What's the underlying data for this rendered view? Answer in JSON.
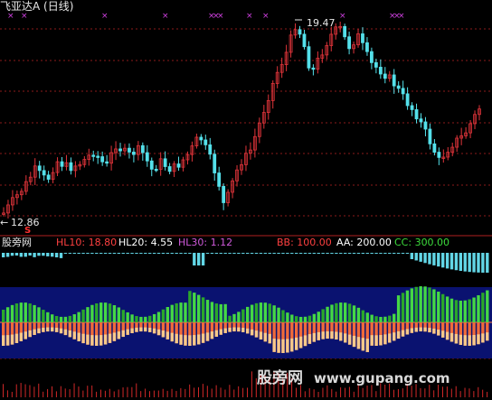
{
  "title": "飞亚达A (日线)",
  "price_high_label": "19.47",
  "price_low_label": "12.86",
  "low_arrow": "←",
  "signal_s": "S",
  "indicator": {
    "name": "股旁网",
    "hl10": "HL10: 18.80",
    "hl20": "HL20: 4.55",
    "hl30": "HL30: 1.12",
    "bb": "BB: 100.00",
    "aa": "AA: 200.00",
    "cc": "CC: 300.00"
  },
  "watermark": {
    "text": "股旁网",
    "url": "www.gupang.com"
  },
  "colors": {
    "up": "#e0343a",
    "down": "#54e0ea",
    "grid": "#8b1a1a",
    "hl10": "#ff4040",
    "hl20": "#ffffff",
    "hl30": "#d05adc",
    "bb": "#ff4040",
    "aa": "#ffffff",
    "cc": "#3cdc3c",
    "mark": "#d040e0",
    "navy": "#0a1270"
  }
}
